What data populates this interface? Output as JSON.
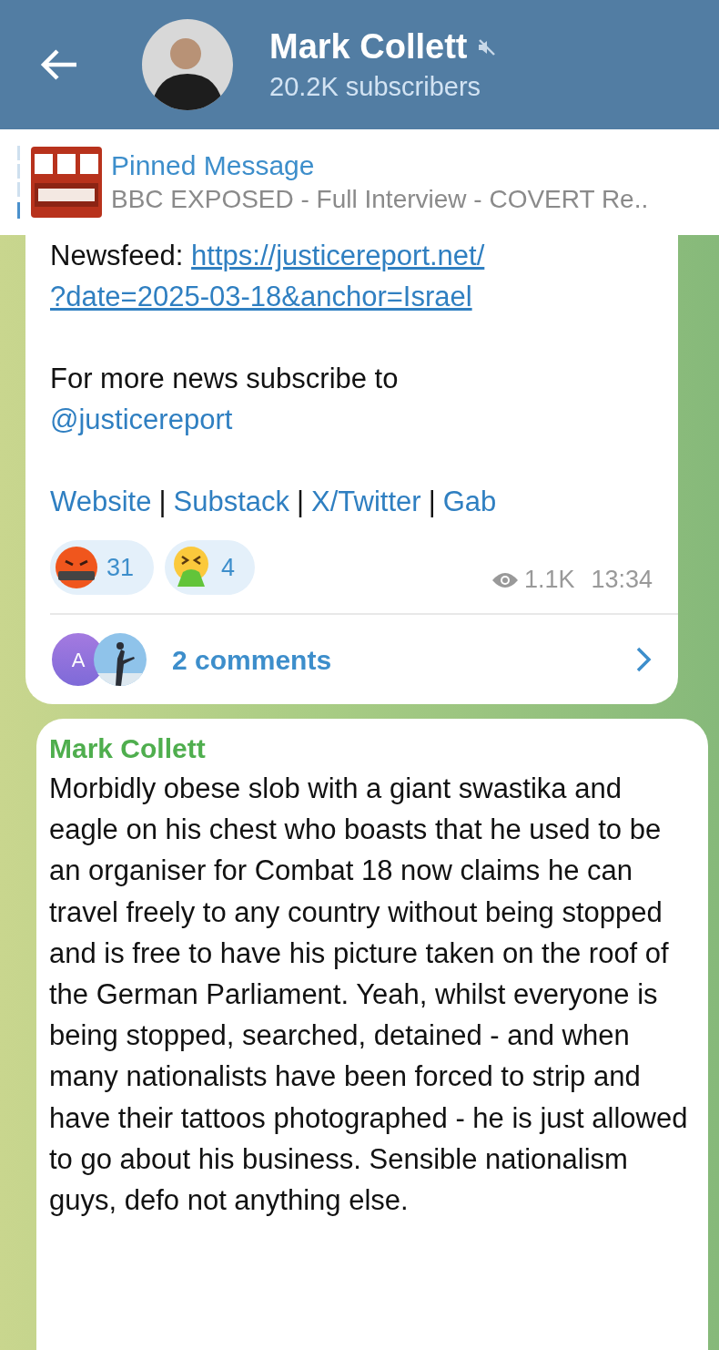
{
  "header": {
    "title": "Mark Collett",
    "subtitle": "20.2K subscribers",
    "muted": true
  },
  "pinned": {
    "label": "Pinned Message",
    "text": "BBC EXPOSED - Full Interview - COVERT Re.."
  },
  "post": {
    "prefix": "Newsfeed:",
    "link_lines": [
      "https://justicereport.net/",
      "?date=2025-03-18&anchor=Israel"
    ],
    "subscribe_text": "For more news subscribe to",
    "subscribe_link": "@justicereport",
    "footer_items": [
      {
        "kind": "link",
        "text": "Website"
      },
      {
        "kind": "separator",
        "text": "|"
      },
      {
        "kind": "link",
        "text": "Substack"
      },
      {
        "kind": "separator",
        "text": "|"
      },
      {
        "kind": "link",
        "text": "X/Twitter"
      },
      {
        "kind": "separator",
        "text": "|"
      },
      {
        "kind": "link",
        "text": "Gab"
      }
    ],
    "reactions": [
      {
        "kind": "angry",
        "count": "31"
      },
      {
        "kind": "vomit",
        "count": "4"
      }
    ],
    "views": "1.1K",
    "time": "13:34",
    "comments": {
      "avatar_letter": "A",
      "label": "2 comments"
    }
  },
  "next_post": {
    "author": "Mark Collett",
    "text": "Morbidly obese slob with a giant swastika and eagle on his chest who boasts that he used to be an organiser for Combat 18 now claims he can travel freely to any country without being stopped and is free to have his picture taken on the roof of the German Parliament. Yeah, whilst everyone is being stopped, searched, detained - and when many nationalists have been forced to strip and have their tattoos photographed - he is just allowed to go about his business. Sensible nationalism guys, defo not anything else."
  }
}
